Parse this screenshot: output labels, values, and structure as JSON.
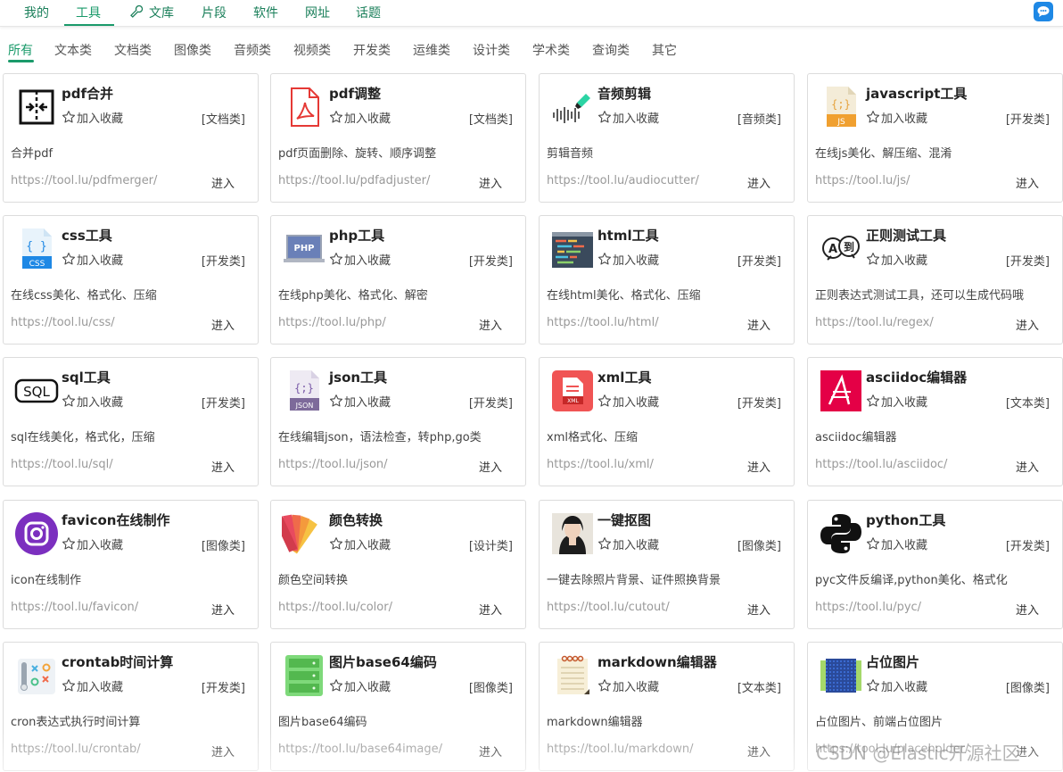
{
  "topnav": {
    "items": [
      {
        "label": "我的"
      },
      {
        "label": "工具"
      },
      {
        "label": "文库"
      },
      {
        "label": "片段"
      },
      {
        "label": "软件"
      },
      {
        "label": "网址"
      },
      {
        "label": "话题"
      }
    ],
    "active_index": 1,
    "chat_icon": "chat-bubble-icon"
  },
  "categories": {
    "tabs": [
      "所有",
      "文本类",
      "文档类",
      "图像类",
      "音频类",
      "视频类",
      "开发类",
      "运维类",
      "设计类",
      "学术类",
      "查询类",
      "其它"
    ],
    "active_index": 0
  },
  "common": {
    "fav_label": "加入收藏",
    "enter_label": "进入"
  },
  "cards": [
    {
      "title": "pdf合并",
      "category": "[文档类]",
      "desc": "合并pdf",
      "url": "https://tool.lu/pdfmerger/",
      "icon": "pdf-merge-icon"
    },
    {
      "title": "pdf调整",
      "category": "[文档类]",
      "desc": "pdf页面删除、旋转、顺序调整",
      "url": "https://tool.lu/pdfadjuster/",
      "icon": "pdf-file-icon"
    },
    {
      "title": "音频剪辑",
      "category": "[音频类]",
      "desc": "剪辑音频",
      "url": "https://tool.lu/audiocutter/",
      "icon": "audio-cut-icon"
    },
    {
      "title": "javascript工具",
      "category": "[开发类]",
      "desc": "在线js美化、解压缩、混淆",
      "url": "https://tool.lu/js/",
      "icon": "js-file-icon"
    },
    {
      "title": "css工具",
      "category": "[开发类]",
      "desc": "在线css美化、格式化、压缩",
      "url": "https://tool.lu/css/",
      "icon": "css-file-icon"
    },
    {
      "title": "php工具",
      "category": "[开发类]",
      "desc": "在线php美化、格式化、解密",
      "url": "https://tool.lu/php/",
      "icon": "php-laptop-icon"
    },
    {
      "title": "html工具",
      "category": "[开发类]",
      "desc": "在线html美化、格式化、压缩",
      "url": "https://tool.lu/html/",
      "icon": "html-code-icon"
    },
    {
      "title": "正则测试工具",
      "category": "[开发类]",
      "desc": "正则表达式测试工具，还可以生成代码哦",
      "url": "https://tool.lu/regex/",
      "icon": "regex-icon"
    },
    {
      "title": "sql工具",
      "category": "[开发类]",
      "desc": "sql在线美化，格式化，压缩",
      "url": "https://tool.lu/sql/",
      "icon": "sql-icon"
    },
    {
      "title": "json工具",
      "category": "[开发类]",
      "desc": "在线编辑json，语法检查，转php,go类",
      "url": "https://tool.lu/json/",
      "icon": "json-file-icon"
    },
    {
      "title": "xml工具",
      "category": "[开发类]",
      "desc": "xml格式化、压缩",
      "url": "https://tool.lu/xml/",
      "icon": "xml-file-icon"
    },
    {
      "title": "asciidoc编辑器",
      "category": "[文本类]",
      "desc": "asciidoc编辑器",
      "url": "https://tool.lu/asciidoc/",
      "icon": "asciidoc-icon"
    },
    {
      "title": "favicon在线制作",
      "category": "[图像类]",
      "desc": "icon在线制作",
      "url": "https://tool.lu/favicon/",
      "icon": "favicon-icon"
    },
    {
      "title": "颜色转换",
      "category": "[设计类]",
      "desc": "颜色空间转换",
      "url": "https://tool.lu/color/",
      "icon": "color-palette-icon"
    },
    {
      "title": "一键抠图",
      "category": "[图像类]",
      "desc": "一键去除照片背景、证件照换背景",
      "url": "https://tool.lu/cutout/",
      "icon": "portrait-photo-icon"
    },
    {
      "title": "python工具",
      "category": "[开发类]",
      "desc": "pyc文件反编译,python美化、格式化",
      "url": "https://tool.lu/pyc/",
      "icon": "python-icon"
    },
    {
      "title": "crontab时间计算",
      "category": "[开发类]",
      "desc": "cron表达式执行时间计算",
      "url": "https://tool.lu/crontab/",
      "icon": "crontab-icon"
    },
    {
      "title": "图片base64编码",
      "category": "[图像类]",
      "desc": "图片base64编码",
      "url": "https://tool.lu/base64image/",
      "icon": "base64-image-icon"
    },
    {
      "title": "markdown编辑器",
      "category": "[文本类]",
      "desc": "markdown编辑器",
      "url": "https://tool.lu/markdown/",
      "icon": "markdown-notebook-icon"
    },
    {
      "title": "占位图片",
      "category": "[图像类]",
      "desc": "占位图片、前端占位图片",
      "url": "https://tool.lu/placeholder/",
      "icon": "placeholder-image-icon"
    }
  ],
  "watermark": "CSDN @Elastic开源社区"
}
